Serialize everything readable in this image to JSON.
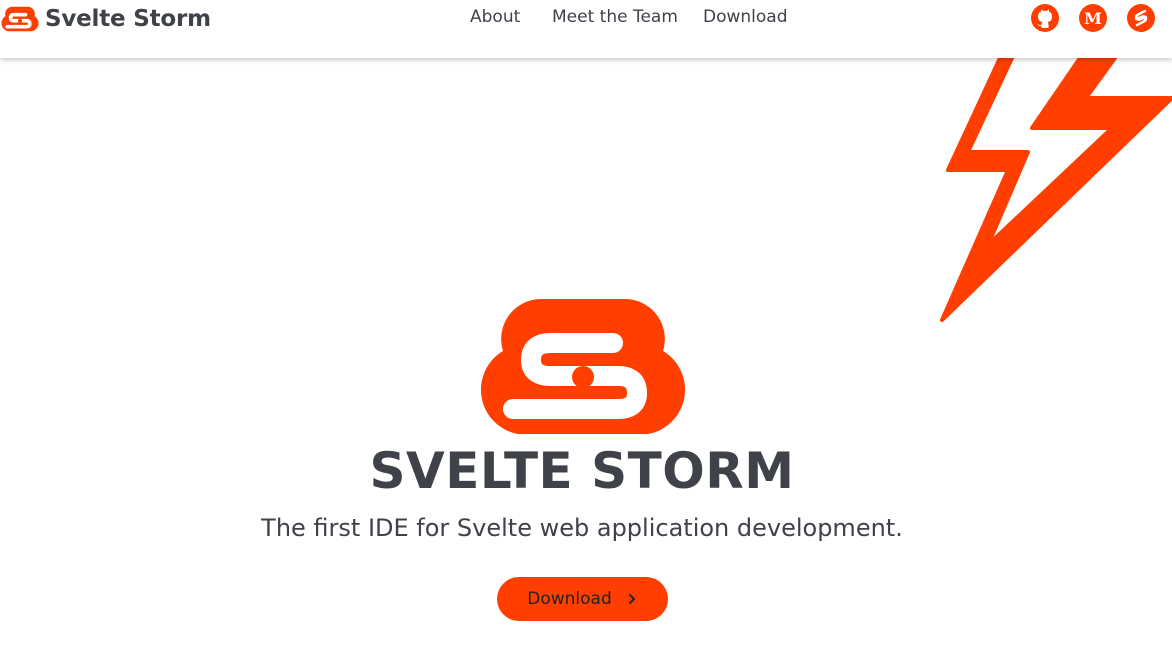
{
  "brand": {
    "name": "Svelte Storm",
    "accent_color": "#ff3e00",
    "text_color": "#40424a",
    "logo_icon": "svelte-storm-cloud-icon"
  },
  "nav": {
    "items": [
      {
        "label": "About"
      },
      {
        "label": "Meet the Team"
      },
      {
        "label": "Download"
      }
    ]
  },
  "social": [
    {
      "icon": "github-icon"
    },
    {
      "icon": "medium-icon"
    },
    {
      "icon": "svelte-icon"
    }
  ],
  "decor": {
    "icon": "lightning-bolt-icon"
  },
  "hero": {
    "title": "SVELTE STORM",
    "subtitle": "The first IDE for Svelte web application development.",
    "cta_label": "Download",
    "cta_icon": "chevron-right-icon"
  }
}
